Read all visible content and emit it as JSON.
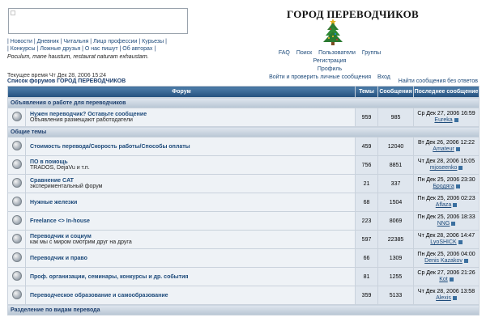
{
  "left_nav": {
    "items": [
      "Новости",
      "Дневник",
      "Читальня",
      "Лицо профессии",
      "Курьезы",
      "Конкурсы",
      "Ложные друзья",
      "О нас пишут",
      "Об авторах"
    ]
  },
  "quote": "Poculum, mane haustum, restaurat naturam exhaustam.",
  "site_title": "ГОРОД ПЕРЕВОДЧИКОВ",
  "top_nav": {
    "row1": [
      "FAQ",
      "Поиск",
      "Пользователи",
      "Группы",
      "Регистрация"
    ],
    "row2": [
      "Профиль",
      "Войти и проверить личные сообщения",
      "Вход"
    ]
  },
  "current_time": "Текущее время Чт Дек 28, 2006 15:24",
  "breadcrumb": "Список форумов ГОРОД ПЕРЕВОДЧИКОВ",
  "no_reply_link": "Найти сообщения без ответов",
  "table": {
    "headers": [
      "Форум",
      "Темы",
      "Сообщения",
      "Последнее сообщение"
    ]
  },
  "categories": [
    {
      "title": "Объявления о работе для переводчиков",
      "forums": [
        {
          "title": "Нужен переводчик? Оставьте сообщение",
          "desc": "Объявления размещают работодатели",
          "topics": "959",
          "posts": "985",
          "last_date": "Ср Дек 27, 2006 16:59",
          "last_user": "Eureka"
        }
      ]
    },
    {
      "title": "Общие темы",
      "forums": [
        {
          "title": "Стоимость перевода/Скорость работы/Способы оплаты",
          "desc": "",
          "topics": "459",
          "posts": "12040",
          "last_date": "Вт Дек 26, 2006 12:22",
          "last_user": "Amateur"
        },
        {
          "title": "ПО в помощь",
          "desc": "TRADOS, DejaVu и т.п.",
          "topics": "756",
          "posts": "8851",
          "last_date": "Чт Дек 28, 2006 15:05",
          "last_user": "mjoseenko"
        },
        {
          "title": "Сравнение CAT",
          "desc": "экспериментальный форум",
          "topics": "21",
          "posts": "337",
          "last_date": "Пн Дек 25, 2006 23:30",
          "last_user": "Бродяга"
        },
        {
          "title": "Нужные железки",
          "desc": "",
          "topics": "68",
          "posts": "1504",
          "last_date": "Пн Дек 25, 2006 02:23",
          "last_user": "Aflaza"
        },
        {
          "title": "Freelance <> In-house",
          "desc": "",
          "topics": "223",
          "posts": "8069",
          "last_date": "Пн Дек 25, 2006 18:33",
          "last_user": "NNG"
        },
        {
          "title": "Переводчик и социум",
          "desc": "как мы с миром смотрим друг на друга",
          "topics": "597",
          "posts": "22385",
          "last_date": "Чт Дек 28, 2006 14:47",
          "last_user": "LyoSHICK"
        },
        {
          "title": "Переводчик и право",
          "desc": "",
          "topics": "66",
          "posts": "1309",
          "last_date": "Пн Дек 25, 2006 04:00",
          "last_user": "Denis Kazakov"
        },
        {
          "title": "Проф. организации, семинары, конкурсы и др. события",
          "desc": "",
          "topics": "81",
          "posts": "1255",
          "last_date": "Ср Дек 27, 2006 21:26",
          "last_user": "Kot"
        },
        {
          "title": "Переводческое образование и самообразование",
          "desc": "",
          "topics": "359",
          "posts": "5133",
          "last_date": "Чт Дек 28, 2006 13:58",
          "last_user": "Alexis"
        }
      ]
    },
    {
      "title": "Разделение по видам перевода",
      "forums": []
    }
  ]
}
